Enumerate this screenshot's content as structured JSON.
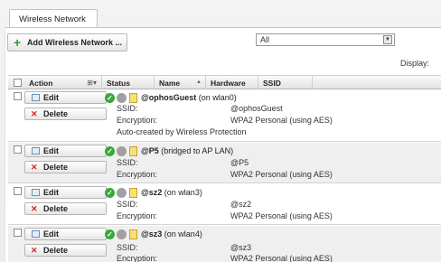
{
  "tab": {
    "label": "Wireless Network"
  },
  "toolbar": {
    "add_label": "Add Wireless Network ...",
    "filter_value": "All",
    "display_label": "Display:"
  },
  "columns": {
    "action": "Action",
    "status": "Status",
    "name": "Name",
    "hardware": "Hardware",
    "ssid": "SSID",
    "sort_icon": "⊞▾",
    "name_sort": "▲"
  },
  "buttons": {
    "edit": "Edit",
    "delete": "Delete"
  },
  "labels": {
    "ssid": "SSID:",
    "encryption": "Encryption:"
  },
  "rows": [
    {
      "name": "@ophosGuest",
      "suffix": " (on wlan0)",
      "ssid": "@ophosGuest",
      "encryption": "WPA2 Personal (using AES)",
      "note": "Auto-created by Wireless Protection"
    },
    {
      "name": "@P5",
      "suffix": " (bridged to AP LAN)",
      "ssid": "@P5",
      "encryption": "WPA2 Personal (using AES)"
    },
    {
      "name": "@sz2",
      "suffix": " (on wlan3)",
      "ssid": "@sz2",
      "encryption": "WPA2 Personal (using AES)"
    },
    {
      "name": "@sz3",
      "suffix": " (on wlan4)",
      "ssid": "@sz3",
      "encryption": "WPA2 Personal (using AES)"
    }
  ],
  "icons": {
    "status_ok": "check-circle-icon",
    "status_off": "grey-circle-icon",
    "note": "note-icon",
    "edit": "edit-icon",
    "delete": "x-icon",
    "add": "plus-icon"
  },
  "colors": {
    "status_ok": "#39a83a",
    "delete_x": "#dd2222",
    "add_plus": "#2f9a2f"
  }
}
